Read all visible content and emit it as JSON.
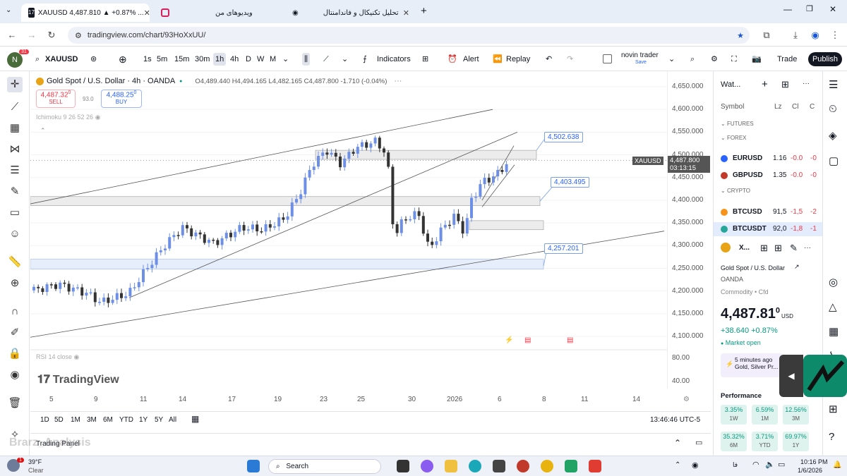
{
  "browser": {
    "tabs": [
      {
        "title": "XAUUSD 4,487.810 ▲ +0.87% ...",
        "active": true
      },
      {
        "title": "ویدیوهای من",
        "active": false
      },
      {
        "title": "تحلیل تکنیکال و فاندامنتال",
        "active": false
      }
    ],
    "url": "tradingview.com/chart/93HoXxUU/",
    "new_tab": "+"
  },
  "toolbar": {
    "symbol": "XAUUSD",
    "intervals": [
      "1s",
      "5m",
      "15m",
      "30m",
      "1h",
      "4h",
      "D",
      "W",
      "M"
    ],
    "selected_interval": "1h",
    "indicators_label": "Indicators",
    "alert_label": "Alert",
    "replay_label": "Replay",
    "layout_name": "novin trader",
    "layout_sub": "Save",
    "trade_label": "Trade",
    "publish_label": "Publish",
    "avatar_badge": "31"
  },
  "chart": {
    "title": "Gold Spot / U.S. Dollar · 4h · OANDA",
    "ohlc": "O4,489.440 H4,494.165 L4,482.165 C4,487.800 -1.710 (-0.04%)",
    "sell_price": "4,487.32",
    "sell_sup": "0",
    "sell_label": "SELL",
    "spread": "93.0",
    "buy_price": "4,488.25",
    "buy_sup": "0",
    "buy_label": "BUY",
    "indicator1": "Ichimoku 9 26 52 26",
    "indicator2": "RSI 14 close",
    "watermark": "TradingView",
    "labels": [
      "4,502.638",
      "4,403.495",
      "4,257.201"
    ],
    "current_symbol": "XAUUSD",
    "current_price": "4,487.800",
    "countdown": "03:13:15",
    "price_ticks": [
      "4,650.000",
      "4,600.000",
      "4,550.000",
      "4,500.000",
      "4,450.000",
      "4,400.000",
      "4,350.000",
      "4,300.000",
      "4,250.000",
      "4,200.000",
      "4,150.000",
      "4,100.000"
    ],
    "rsi_ticks": [
      "80.00",
      "40.00"
    ],
    "time_ticks": [
      "5",
      "9",
      "11",
      "14",
      "17",
      "19",
      "23",
      "25",
      "30",
      "2026",
      "6",
      "8",
      "11",
      "14"
    ],
    "ranges": [
      "1D",
      "5D",
      "1M",
      "3M",
      "6M",
      "YTD",
      "1Y",
      "5Y",
      "All"
    ],
    "clock": "13:46:46 UTC-5",
    "trading_panel": "Trading Panel",
    "overlay_watermark": "Brarz_Analysis"
  },
  "chart_data": {
    "type": "candlestick",
    "title": "Gold Spot / U.S. Dollar · 4h · OANDA",
    "ylim": [
      4080,
      4670
    ],
    "annotations": [
      4502.638,
      4403.495,
      4257.201
    ],
    "last": 4487.8
  },
  "watchlist": {
    "header": "Wat...",
    "columns": [
      "Symbol",
      "Lz",
      "Cl",
      "C"
    ],
    "sections": [
      "FUTURES",
      "FOREX",
      "CRYPTO"
    ],
    "rows": [
      {
        "symbol": "EURUSD",
        "last": "1.16",
        "chg": "-0.0",
        "pct": "-0"
      },
      {
        "symbol": "GBPUSD",
        "last": "1.35",
        "chg": "-0.0",
        "pct": "-0"
      },
      {
        "symbol": "BTCUSD",
        "last": "91,5",
        "chg": "-1,5",
        "pct": "-2"
      },
      {
        "symbol": "BTCUSDT",
        "last": "92,0",
        "chg": "-1,8",
        "pct": "-1"
      }
    ],
    "detail_symbol": "X...",
    "detail_name": "Gold Spot / U.S. Dollar",
    "detail_exchange": "OANDA",
    "detail_type": "Commodity • Cfd",
    "price_main": "4,487.81",
    "price_sup": "0",
    "price_cur": "USD",
    "change": "+38.640 +0.87%",
    "market_status": "Market open",
    "news_time": "5 minutes ago",
    "news_text": "Gold, Silver Pr...",
    "performance_label": "Performance",
    "perf": [
      {
        "v": "3.35%",
        "p": "1W"
      },
      {
        "v": "6.59%",
        "p": "1M"
      },
      {
        "v": "12.56%",
        "p": "3M"
      },
      {
        "v": "35.32%",
        "p": "6M"
      },
      {
        "v": "3.71%",
        "p": "YTD"
      },
      {
        "v": "69.97%",
        "p": "1Y"
      }
    ]
  },
  "taskbar": {
    "weather_temp": "39°F",
    "weather_desc": "Clear",
    "weather_badge": "1",
    "search_placeholder": "Search",
    "time": "10:16 PM",
    "date": "1/6/2026"
  }
}
